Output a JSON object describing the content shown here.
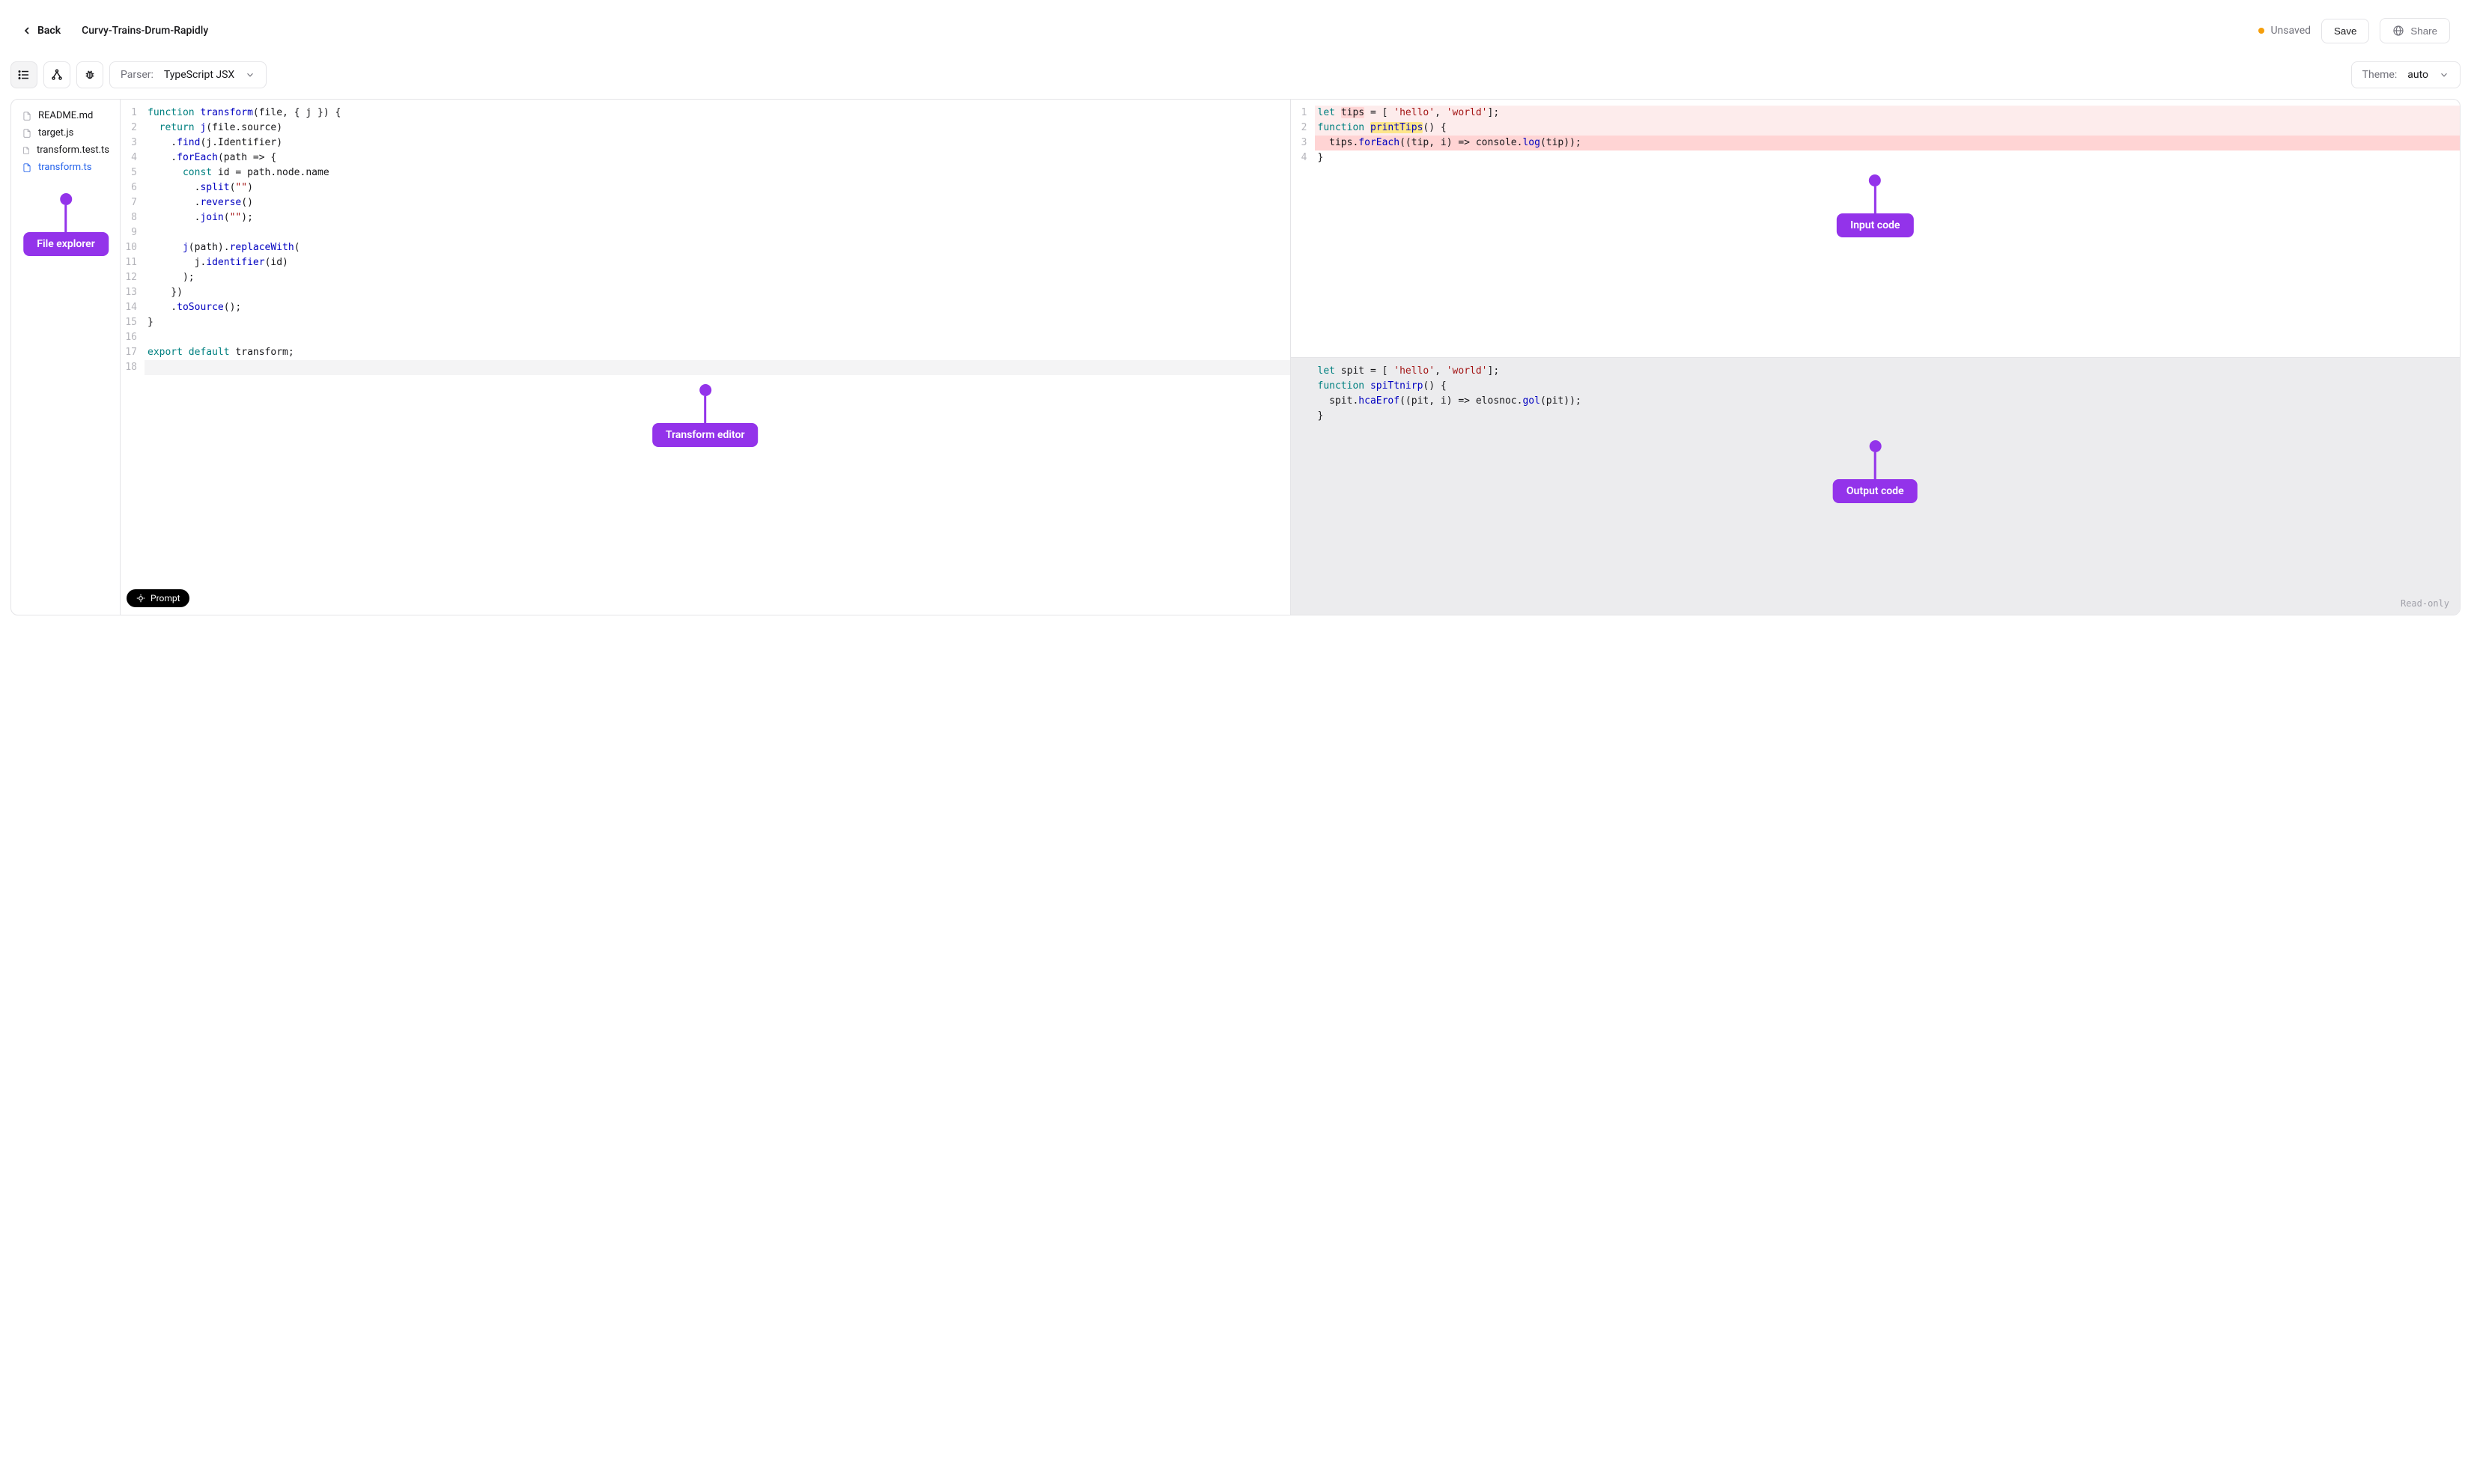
{
  "header": {
    "back_label": "Back",
    "title": "Curvy-Trains-Drum-Rapidly",
    "unsaved_label": "Unsaved",
    "save_label": "Save",
    "share_label": "Share"
  },
  "toolbar": {
    "parser_label": "Parser:",
    "parser_value": "TypeScript JSX",
    "theme_label": "Theme:",
    "theme_value": "auto"
  },
  "sidebar": {
    "files": [
      {
        "name": "README.md",
        "active": false
      },
      {
        "name": "target.js",
        "active": false
      },
      {
        "name": "transform.test.ts",
        "active": false
      },
      {
        "name": "transform.ts",
        "active": true
      }
    ]
  },
  "transform_editor": {
    "lines": [
      [
        {
          "c": "kw",
          "t": "function"
        },
        {
          "c": "pl",
          "t": " "
        },
        {
          "c": "fn",
          "t": "transform"
        },
        {
          "c": "pl",
          "t": "(file, { j }) {"
        }
      ],
      [
        {
          "c": "pl",
          "t": "  "
        },
        {
          "c": "kw",
          "t": "return"
        },
        {
          "c": "pl",
          "t": " "
        },
        {
          "c": "fn",
          "t": "j"
        },
        {
          "c": "pl",
          "t": "(file.source)"
        }
      ],
      [
        {
          "c": "pl",
          "t": "    ."
        },
        {
          "c": "fn",
          "t": "find"
        },
        {
          "c": "pl",
          "t": "(j.Identifier)"
        }
      ],
      [
        {
          "c": "pl",
          "t": "    ."
        },
        {
          "c": "fn",
          "t": "forEach"
        },
        {
          "c": "pl",
          "t": "(path => {"
        }
      ],
      [
        {
          "c": "pl",
          "t": "      "
        },
        {
          "c": "kw",
          "t": "const"
        },
        {
          "c": "pl",
          "t": " id = path.node.name"
        }
      ],
      [
        {
          "c": "pl",
          "t": "        ."
        },
        {
          "c": "fn",
          "t": "split"
        },
        {
          "c": "pl",
          "t": "("
        },
        {
          "c": "str",
          "t": "\"\""
        },
        {
          "c": "pl",
          "t": ")"
        }
      ],
      [
        {
          "c": "pl",
          "t": "        ."
        },
        {
          "c": "fn",
          "t": "reverse"
        },
        {
          "c": "pl",
          "t": "()"
        }
      ],
      [
        {
          "c": "pl",
          "t": "        ."
        },
        {
          "c": "fn",
          "t": "join"
        },
        {
          "c": "pl",
          "t": "("
        },
        {
          "c": "str",
          "t": "\"\""
        },
        {
          "c": "pl",
          "t": ");"
        }
      ],
      [
        {
          "c": "pl",
          "t": ""
        }
      ],
      [
        {
          "c": "pl",
          "t": "      "
        },
        {
          "c": "fn",
          "t": "j"
        },
        {
          "c": "pl",
          "t": "(path)."
        },
        {
          "c": "fn",
          "t": "replaceWith"
        },
        {
          "c": "pl",
          "t": "("
        }
      ],
      [
        {
          "c": "pl",
          "t": "        j."
        },
        {
          "c": "fn",
          "t": "identifier"
        },
        {
          "c": "pl",
          "t": "(id)"
        }
      ],
      [
        {
          "c": "pl",
          "t": "      );"
        }
      ],
      [
        {
          "c": "pl",
          "t": "    })"
        }
      ],
      [
        {
          "c": "pl",
          "t": "    ."
        },
        {
          "c": "fn",
          "t": "toSource"
        },
        {
          "c": "pl",
          "t": "();"
        }
      ],
      [
        {
          "c": "pl",
          "t": "}"
        }
      ],
      [
        {
          "c": "pl",
          "t": ""
        }
      ],
      [
        {
          "c": "kw",
          "t": "export"
        },
        {
          "c": "pl",
          "t": " "
        },
        {
          "c": "kw",
          "t": "default"
        },
        {
          "c": "pl",
          "t": " transform;"
        }
      ],
      [
        {
          "c": "pl",
          "t": ""
        }
      ]
    ],
    "cursor_line_index": 17
  },
  "input_code": {
    "lines": [
      {
        "hl": "line",
        "tokens": [
          {
            "c": "kw",
            "t": "let"
          },
          {
            "c": "pl",
            "t": " "
          },
          {
            "c": "pl",
            "t": "tips",
            "hl": "red"
          },
          {
            "c": "pl",
            "t": " = [ "
          },
          {
            "c": "str",
            "t": "'hello'"
          },
          {
            "c": "pl",
            "t": ", "
          },
          {
            "c": "str",
            "t": "'world'"
          },
          {
            "c": "pl",
            "t": "];"
          }
        ]
      },
      {
        "hl": "line",
        "tokens": [
          {
            "c": "kw",
            "t": "function"
          },
          {
            "c": "pl",
            "t": " "
          },
          {
            "c": "fn",
            "t": "printTips",
            "hl": "yellow"
          },
          {
            "c": "pl",
            "t": "() {"
          }
        ]
      },
      {
        "hl": "line-strong",
        "tokens": [
          {
            "c": "pl",
            "t": "  tips."
          },
          {
            "c": "fn",
            "t": "forEach"
          },
          {
            "c": "pl",
            "t": "((tip, i) => console."
          },
          {
            "c": "fn",
            "t": "log"
          },
          {
            "c": "pl",
            "t": "(tip));"
          }
        ]
      },
      {
        "tokens": [
          {
            "c": "pl",
            "t": "}"
          }
        ]
      }
    ]
  },
  "output_code": {
    "lines": [
      [
        {
          "c": "kw",
          "t": "let"
        },
        {
          "c": "pl",
          "t": " spit = [ "
        },
        {
          "c": "str",
          "t": "'hello'"
        },
        {
          "c": "pl",
          "t": ", "
        },
        {
          "c": "str",
          "t": "'world'"
        },
        {
          "c": "pl",
          "t": "];"
        }
      ],
      [
        {
          "c": "kw",
          "t": "function"
        },
        {
          "c": "pl",
          "t": " "
        },
        {
          "c": "fn",
          "t": "spiTtnirp"
        },
        {
          "c": "pl",
          "t": "() {"
        }
      ],
      [
        {
          "c": "pl",
          "t": "  spit."
        },
        {
          "c": "fn",
          "t": "hcaErof"
        },
        {
          "c": "pl",
          "t": "((pit, i) => elosnoc."
        },
        {
          "c": "fn",
          "t": "gol"
        },
        {
          "c": "pl",
          "t": "(pit));"
        }
      ],
      [
        {
          "c": "pl",
          "t": "}"
        }
      ]
    ],
    "readonly_label": "Read-only"
  },
  "prompt_button": "Prompt",
  "callouts": {
    "file_explorer": "File explorer",
    "transform_editor": "Transform editor",
    "input_code": "Input code",
    "output_code": "Output code"
  }
}
